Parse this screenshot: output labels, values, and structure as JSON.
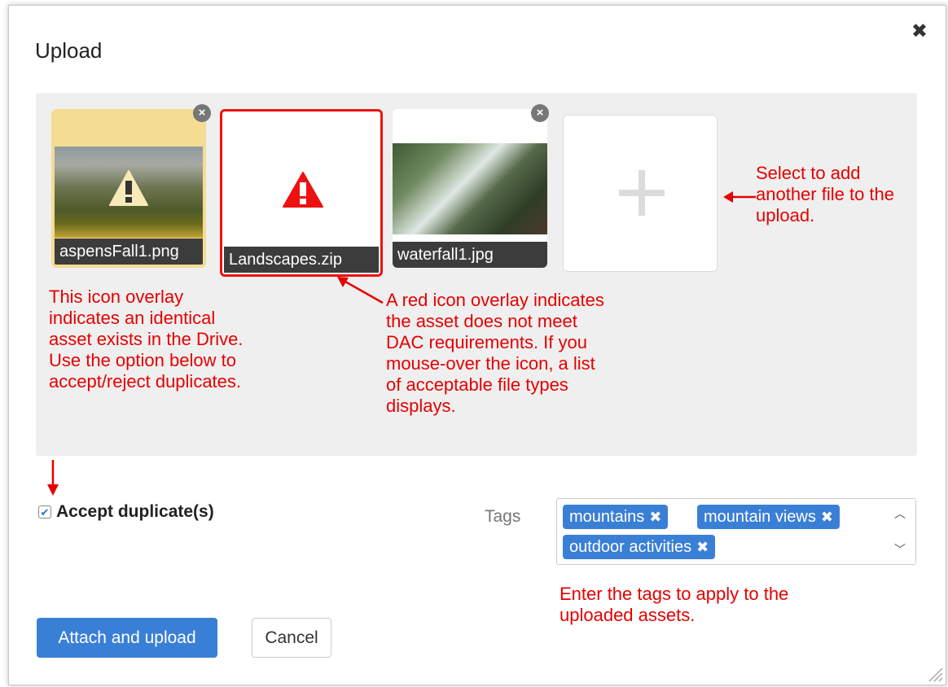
{
  "dialog": {
    "title": "Upload",
    "close_icon": "✖"
  },
  "files": [
    {
      "name": "aspensFall1.png",
      "status": "warning",
      "icon": "warning-triangle-icon"
    },
    {
      "name": "Landscapes.zip",
      "status": "error",
      "icon": "warning-triangle-icon"
    },
    {
      "name": "waterfall1.jpg",
      "status": "ok",
      "icon": ""
    }
  ],
  "add_tile": {
    "icon": "plus-icon"
  },
  "annotations": {
    "duplicate": "This icon overlay indicates an identical asset exists in the Drive. Use the option below to accept/reject duplicates.",
    "error": "A red icon overlay indicates the asset does not meet DAC requirements. If you mouse-over the icon, a list of acceptable file types displays.",
    "add": "Select to add another file to the upload.",
    "tags": "Enter the tags to apply to the uploaded assets."
  },
  "options": {
    "accept_duplicates_label": "Accept duplicate(s)",
    "accept_duplicates_checked": true
  },
  "tags": {
    "label": "Tags",
    "items": [
      "mountains",
      "mountain views",
      "outdoor activities"
    ]
  },
  "buttons": {
    "attach": "Attach and upload",
    "cancel": "Cancel"
  },
  "colors": {
    "accent": "#3a7fd6",
    "error": "#ee1111",
    "warning_border": "#f4dc92",
    "annotation": "#e60000"
  }
}
